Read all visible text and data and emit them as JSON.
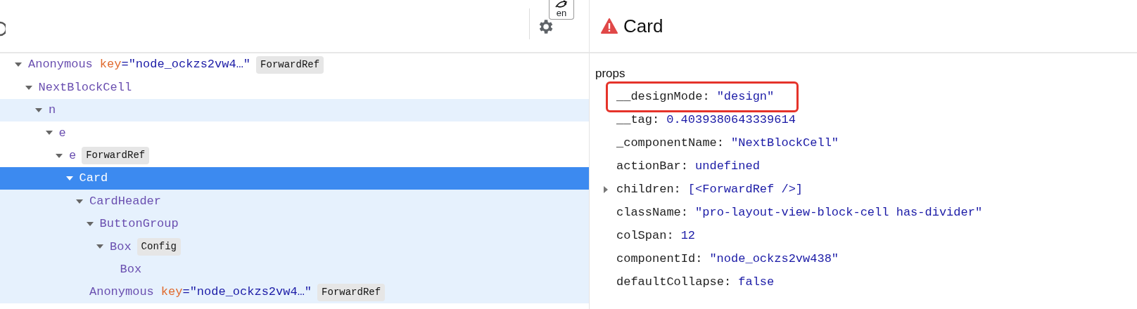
{
  "overlay_badge": {
    "text": "en"
  },
  "tree": [
    {
      "name": "Anonymous",
      "key_name": "key",
      "key_value": "=\"node_ockzs2vw4…\"",
      "badge": "ForwardRef",
      "expanded": true,
      "highlighted": false,
      "selected": false,
      "children": [
        {
          "name": "NextBlockCell",
          "expanded": true,
          "highlighted": false,
          "selected": false,
          "children": [
            {
              "name": "n",
              "expanded": true,
              "highlighted": true,
              "selected": false,
              "children": [
                {
                  "name": "e",
                  "expanded": true,
                  "highlighted": false,
                  "selected": false,
                  "children": [
                    {
                      "name": "e",
                      "badge": "ForwardRef",
                      "expanded": true,
                      "highlighted": false,
                      "selected": false,
                      "children": [
                        {
                          "name": "Card",
                          "expanded": true,
                          "selected": true,
                          "children": [
                            {
                              "name": "CardHeader",
                              "expanded": true,
                              "highlighted": true,
                              "selected": false,
                              "children": [
                                {
                                  "name": "ButtonGroup",
                                  "expanded": true,
                                  "highlighted": true,
                                  "selected": false,
                                  "children": [
                                    {
                                      "name": "Box",
                                      "badge": "Config",
                                      "expanded": true,
                                      "highlighted": true,
                                      "selected": false,
                                      "children": [
                                        {
                                          "name": "Box",
                                          "highlighted": true,
                                          "selected": false
                                        }
                                      ]
                                    }
                                  ]
                                }
                              ]
                            },
                            {
                              "name": "Anonymous",
                              "key_name": "key",
                              "key_value": "=\"node_ockzs2vw4…\"",
                              "badge": "ForwardRef",
                              "highlighted": true,
                              "selected": false
                            }
                          ]
                        }
                      ]
                    }
                  ]
                }
              ]
            }
          ]
        }
      ]
    }
  ],
  "inspector": {
    "title": "Card",
    "section": "props",
    "props": [
      {
        "kind": "value",
        "name": "__designMode:",
        "value": "\"design\"",
        "outlined": true
      },
      {
        "kind": "value",
        "name": "__tag:",
        "value": "0.4039380643339614",
        "outlined": false
      },
      {
        "kind": "value",
        "name": "_componentName:",
        "value": "\"NextBlockCell\"",
        "outlined": false
      },
      {
        "kind": "value",
        "name": "actionBar:",
        "value": "undefined",
        "outlined": false
      },
      {
        "kind": "expandable",
        "name": "children:",
        "value": "[<ForwardRef />]",
        "expanded": false,
        "outlined": false
      },
      {
        "kind": "value",
        "name": "className:",
        "value": "\"pro-layout-view-block-cell has-divider\"",
        "outlined": false
      },
      {
        "kind": "value",
        "name": "colSpan:",
        "value": "12",
        "outlined": false
      },
      {
        "kind": "value",
        "name": "componentId:",
        "value": "\"node_ockzs2vw438\"",
        "outlined": false
      },
      {
        "kind": "value",
        "name": "defaultCollapse:",
        "value": "false",
        "outlined": false
      }
    ]
  }
}
